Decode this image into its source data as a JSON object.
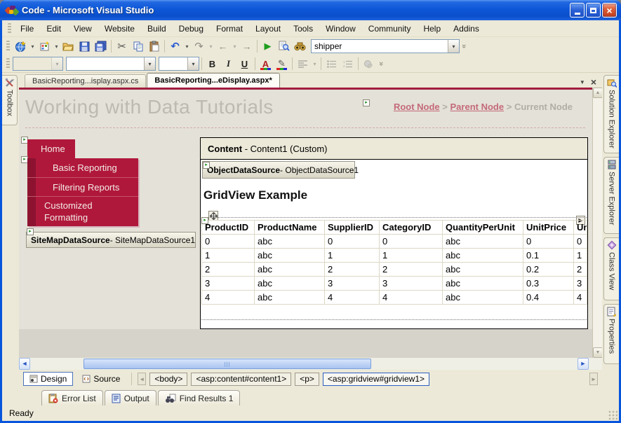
{
  "titlebar": {
    "title": "Code - Microsoft Visual Studio"
  },
  "menus": [
    "File",
    "Edit",
    "View",
    "Website",
    "Build",
    "Debug",
    "Format",
    "Layout",
    "Tools",
    "Window",
    "Community",
    "Help",
    "Addins"
  ],
  "standard_toolbar": {
    "search_value": "shipper"
  },
  "formatting_toolbar": {
    "bold": "B",
    "italic": "I",
    "underline": "U",
    "font_color": "A",
    "highlight": "✎"
  },
  "editor_tabs": [
    {
      "label": "BasicReporting...isplay.aspx.cs"
    },
    {
      "label": "BasicReporting...eDisplay.aspx*"
    }
  ],
  "toolbox": {
    "label": "Toolbox"
  },
  "right_tabs": [
    {
      "label": "Solution Explorer"
    },
    {
      "label": "Server Explorer"
    },
    {
      "label": "Class View"
    },
    {
      "label": "Properties"
    }
  ],
  "page": {
    "title": "Working with Data Tutorials",
    "breadcrumb": {
      "root": "Root Node",
      "sep1": ">",
      "parent": "Parent Node",
      "sep2": ">",
      "current": "Current Node"
    },
    "nav_items": [
      "Home",
      "Basic Reporting",
      "Filtering Reports",
      "Customized Formatting"
    ],
    "sitemap_datasource": {
      "type": "SiteMapDataSource",
      "instance": " - SiteMapDataSource1"
    },
    "content": {
      "type": "Content",
      "instance": " - Content1 (Custom)"
    },
    "object_datasource": {
      "type": "ObjectDataSource",
      "instance": " - ObjectDataSource1"
    },
    "gridview": {
      "heading": "GridView Example",
      "columns": [
        "ProductID",
        "ProductName",
        "SupplierID",
        "CategoryID",
        "QuantityPerUnit",
        "UnitPrice",
        "Uni"
      ],
      "rows": [
        [
          "0",
          "abc",
          "0",
          "0",
          "abc",
          "0",
          "0"
        ],
        [
          "1",
          "abc",
          "1",
          "1",
          "abc",
          "0.1",
          "1"
        ],
        [
          "2",
          "abc",
          "2",
          "2",
          "abc",
          "0.2",
          "2"
        ],
        [
          "3",
          "abc",
          "3",
          "3",
          "abc",
          "0.3",
          "3"
        ],
        [
          "4",
          "abc",
          "4",
          "4",
          "abc",
          "0.4",
          "4"
        ]
      ]
    }
  },
  "view_switcher": {
    "design": "Design",
    "source": "Source"
  },
  "tag_navigator": [
    "<body>",
    "<asp:content#content1>",
    "<p>",
    "<asp:gridview#gridview1>"
  ],
  "bottom_panels": [
    "Error List",
    "Output",
    "Find Results 1"
  ],
  "statusbar": {
    "text": "Ready"
  },
  "icons": {
    "dropdown": "▾",
    "overflow": "»",
    "cut": "✂",
    "undo": "↶",
    "redo": "↷",
    "back": "←",
    "forward": "→",
    "play": "▶",
    "smart_tag": "▸",
    "gridview_arrow": "▶",
    "scroll_up": "▲",
    "scroll_down": "▼",
    "scroll_left": "◄",
    "scroll_right": "►",
    "tag_nav_left": "◄",
    "tag_nav_right": "►",
    "tab_dropdown": "▼",
    "tab_close": "×",
    "close": "×"
  },
  "colors": {
    "accent_red": "#B0183B",
    "nav_dark_red": "#8C1230",
    "luna_blue": "#0A57D8",
    "toolbar_bg": "#ECE9D8",
    "page_bg": "#E4E1D8",
    "link_pink": "#C4697B",
    "title_gray": "#BDBAB1"
  }
}
